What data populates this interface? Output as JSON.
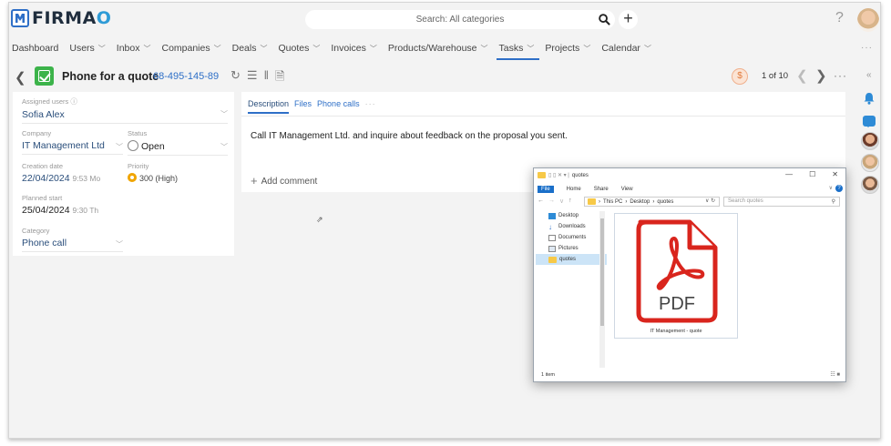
{
  "brand": {
    "logo_text": "FIRMA",
    "logo_o": "O"
  },
  "search": {
    "placeholder": "Search: All categories"
  },
  "nav": {
    "items": [
      {
        "label": "Dashboard",
        "chevron": false,
        "active": false
      },
      {
        "label": "Users",
        "chevron": true,
        "active": false
      },
      {
        "label": "Inbox",
        "chevron": true,
        "active": false
      },
      {
        "label": "Companies",
        "chevron": true,
        "active": false
      },
      {
        "label": "Deals",
        "chevron": true,
        "active": false
      },
      {
        "label": "Quotes",
        "chevron": true,
        "active": false
      },
      {
        "label": "Invoices",
        "chevron": true,
        "active": false
      },
      {
        "label": "Products/Warehouse",
        "chevron": true,
        "active": false
      },
      {
        "label": "Tasks",
        "chevron": true,
        "active": true
      },
      {
        "label": "Projects",
        "chevron": true,
        "active": false
      },
      {
        "label": "Calendar",
        "chevron": true,
        "active": false
      }
    ],
    "more": "···"
  },
  "task": {
    "title": "Phone for a quote",
    "phone": "68-495-145-89",
    "pager": "1 of 10"
  },
  "fields": {
    "assigned_label": "Assigned users",
    "assigned_value": "Sofia Alex",
    "company_label": "Company",
    "company_value": "IT Management Ltd",
    "status_label": "Status",
    "status_value": "Open",
    "creation_label": "Creation date",
    "creation_date": "22/04/2024",
    "creation_time": "9:53 Mo",
    "priority_label": "Priority",
    "priority_value": "300 (High)",
    "planned_label": "Planned start",
    "planned_date": "25/04/2024",
    "planned_time": "9:30 Th",
    "category_label": "Category",
    "category_value": "Phone call"
  },
  "description": {
    "tabs": [
      "Description",
      "Files",
      "Phone calls"
    ],
    "more": "···",
    "text": "Call IT Management Ltd. and inquire about feedback on the proposal you sent.",
    "add_comment": "Add comment"
  },
  "explorer": {
    "title": "quotes",
    "ribbon": [
      "File",
      "Home",
      "Share",
      "View"
    ],
    "path": [
      "This PC",
      "Desktop",
      "quotes"
    ],
    "search_placeholder": "Search quotes",
    "nav_items": [
      "Desktop",
      "Downloads",
      "Documents",
      "Pictures",
      "quotes"
    ],
    "file_name": "IT Management - quote",
    "pdf_label": "PDF",
    "status": "1 item"
  },
  "colors": {
    "accent": "#2e6fc7",
    "task_green": "#3cb34a",
    "pdf_red": "#d9251d"
  }
}
